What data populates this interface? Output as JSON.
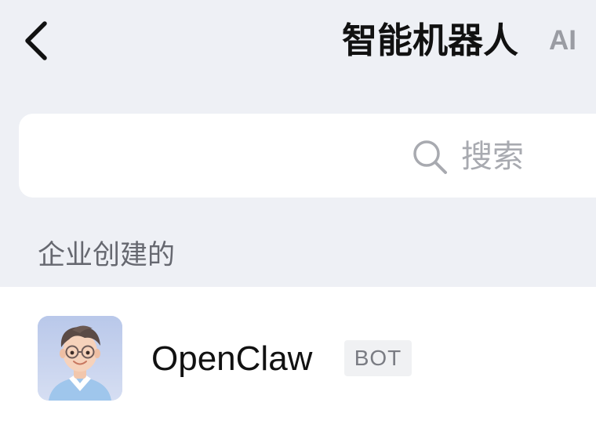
{
  "header": {
    "back_icon": "chevron-left-icon",
    "title": "智能机器人",
    "ai_tag": "AI"
  },
  "search": {
    "icon": "search-icon",
    "placeholder": "搜索"
  },
  "section": {
    "header": "企业创建的"
  },
  "bots": [
    {
      "avatar": "avatar-image",
      "name": "OpenClaw",
      "badge": "BOT"
    }
  ],
  "colors": {
    "background": "#eef0f5",
    "card": "#ffffff",
    "title": "#111111",
    "muted": "#a8aab0",
    "section_text": "#666870",
    "badge_bg": "#f0f1f3"
  }
}
